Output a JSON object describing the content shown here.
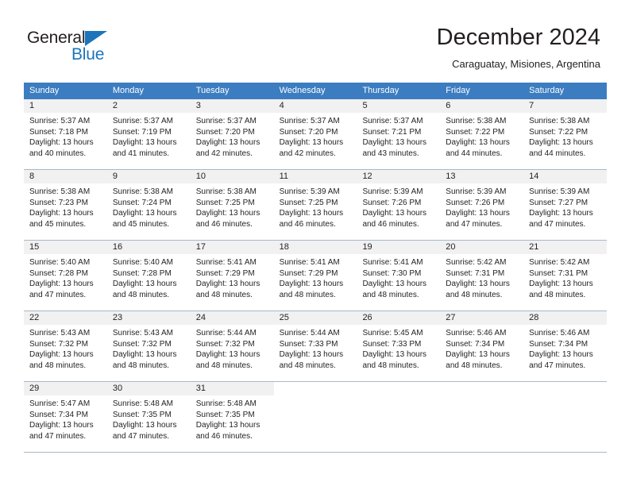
{
  "logo": {
    "word_top": "General",
    "word_bottom": "Blue",
    "triangle_color": "#1b75bb"
  },
  "header": {
    "title": "December 2024",
    "subtitle": "Caraguatay, Misiones, Argentina"
  },
  "theme": {
    "header_bg": "#3b7dc0",
    "header_text": "#ffffff",
    "daynum_bg": "#f1f1f1",
    "grid_line": "#a8b8c8",
    "text": "#231f20"
  },
  "weekdays": [
    "Sunday",
    "Monday",
    "Tuesday",
    "Wednesday",
    "Thursday",
    "Friday",
    "Saturday"
  ],
  "weeks": [
    [
      {
        "day": "1",
        "sunrise": "Sunrise: 5:37 AM",
        "sunset": "Sunset: 7:18 PM",
        "daylight_1": "Daylight: 13 hours",
        "daylight_2": "and 40 minutes."
      },
      {
        "day": "2",
        "sunrise": "Sunrise: 5:37 AM",
        "sunset": "Sunset: 7:19 PM",
        "daylight_1": "Daylight: 13 hours",
        "daylight_2": "and 41 minutes."
      },
      {
        "day": "3",
        "sunrise": "Sunrise: 5:37 AM",
        "sunset": "Sunset: 7:20 PM",
        "daylight_1": "Daylight: 13 hours",
        "daylight_2": "and 42 minutes."
      },
      {
        "day": "4",
        "sunrise": "Sunrise: 5:37 AM",
        "sunset": "Sunset: 7:20 PM",
        "daylight_1": "Daylight: 13 hours",
        "daylight_2": "and 42 minutes."
      },
      {
        "day": "5",
        "sunrise": "Sunrise: 5:37 AM",
        "sunset": "Sunset: 7:21 PM",
        "daylight_1": "Daylight: 13 hours",
        "daylight_2": "and 43 minutes."
      },
      {
        "day": "6",
        "sunrise": "Sunrise: 5:38 AM",
        "sunset": "Sunset: 7:22 PM",
        "daylight_1": "Daylight: 13 hours",
        "daylight_2": "and 44 minutes."
      },
      {
        "day": "7",
        "sunrise": "Sunrise: 5:38 AM",
        "sunset": "Sunset: 7:22 PM",
        "daylight_1": "Daylight: 13 hours",
        "daylight_2": "and 44 minutes."
      }
    ],
    [
      {
        "day": "8",
        "sunrise": "Sunrise: 5:38 AM",
        "sunset": "Sunset: 7:23 PM",
        "daylight_1": "Daylight: 13 hours",
        "daylight_2": "and 45 minutes."
      },
      {
        "day": "9",
        "sunrise": "Sunrise: 5:38 AM",
        "sunset": "Sunset: 7:24 PM",
        "daylight_1": "Daylight: 13 hours",
        "daylight_2": "and 45 minutes."
      },
      {
        "day": "10",
        "sunrise": "Sunrise: 5:38 AM",
        "sunset": "Sunset: 7:25 PM",
        "daylight_1": "Daylight: 13 hours",
        "daylight_2": "and 46 minutes."
      },
      {
        "day": "11",
        "sunrise": "Sunrise: 5:39 AM",
        "sunset": "Sunset: 7:25 PM",
        "daylight_1": "Daylight: 13 hours",
        "daylight_2": "and 46 minutes."
      },
      {
        "day": "12",
        "sunrise": "Sunrise: 5:39 AM",
        "sunset": "Sunset: 7:26 PM",
        "daylight_1": "Daylight: 13 hours",
        "daylight_2": "and 46 minutes."
      },
      {
        "day": "13",
        "sunrise": "Sunrise: 5:39 AM",
        "sunset": "Sunset: 7:26 PM",
        "daylight_1": "Daylight: 13 hours",
        "daylight_2": "and 47 minutes."
      },
      {
        "day": "14",
        "sunrise": "Sunrise: 5:39 AM",
        "sunset": "Sunset: 7:27 PM",
        "daylight_1": "Daylight: 13 hours",
        "daylight_2": "and 47 minutes."
      }
    ],
    [
      {
        "day": "15",
        "sunrise": "Sunrise: 5:40 AM",
        "sunset": "Sunset: 7:28 PM",
        "daylight_1": "Daylight: 13 hours",
        "daylight_2": "and 47 minutes."
      },
      {
        "day": "16",
        "sunrise": "Sunrise: 5:40 AM",
        "sunset": "Sunset: 7:28 PM",
        "daylight_1": "Daylight: 13 hours",
        "daylight_2": "and 48 minutes."
      },
      {
        "day": "17",
        "sunrise": "Sunrise: 5:41 AM",
        "sunset": "Sunset: 7:29 PM",
        "daylight_1": "Daylight: 13 hours",
        "daylight_2": "and 48 minutes."
      },
      {
        "day": "18",
        "sunrise": "Sunrise: 5:41 AM",
        "sunset": "Sunset: 7:29 PM",
        "daylight_1": "Daylight: 13 hours",
        "daylight_2": "and 48 minutes."
      },
      {
        "day": "19",
        "sunrise": "Sunrise: 5:41 AM",
        "sunset": "Sunset: 7:30 PM",
        "daylight_1": "Daylight: 13 hours",
        "daylight_2": "and 48 minutes."
      },
      {
        "day": "20",
        "sunrise": "Sunrise: 5:42 AM",
        "sunset": "Sunset: 7:31 PM",
        "daylight_1": "Daylight: 13 hours",
        "daylight_2": "and 48 minutes."
      },
      {
        "day": "21",
        "sunrise": "Sunrise: 5:42 AM",
        "sunset": "Sunset: 7:31 PM",
        "daylight_1": "Daylight: 13 hours",
        "daylight_2": "and 48 minutes."
      }
    ],
    [
      {
        "day": "22",
        "sunrise": "Sunrise: 5:43 AM",
        "sunset": "Sunset: 7:32 PM",
        "daylight_1": "Daylight: 13 hours",
        "daylight_2": "and 48 minutes."
      },
      {
        "day": "23",
        "sunrise": "Sunrise: 5:43 AM",
        "sunset": "Sunset: 7:32 PM",
        "daylight_1": "Daylight: 13 hours",
        "daylight_2": "and 48 minutes."
      },
      {
        "day": "24",
        "sunrise": "Sunrise: 5:44 AM",
        "sunset": "Sunset: 7:32 PM",
        "daylight_1": "Daylight: 13 hours",
        "daylight_2": "and 48 minutes."
      },
      {
        "day": "25",
        "sunrise": "Sunrise: 5:44 AM",
        "sunset": "Sunset: 7:33 PM",
        "daylight_1": "Daylight: 13 hours",
        "daylight_2": "and 48 minutes."
      },
      {
        "day": "26",
        "sunrise": "Sunrise: 5:45 AM",
        "sunset": "Sunset: 7:33 PM",
        "daylight_1": "Daylight: 13 hours",
        "daylight_2": "and 48 minutes."
      },
      {
        "day": "27",
        "sunrise": "Sunrise: 5:46 AM",
        "sunset": "Sunset: 7:34 PM",
        "daylight_1": "Daylight: 13 hours",
        "daylight_2": "and 48 minutes."
      },
      {
        "day": "28",
        "sunrise": "Sunrise: 5:46 AM",
        "sunset": "Sunset: 7:34 PM",
        "daylight_1": "Daylight: 13 hours",
        "daylight_2": "and 47 minutes."
      }
    ],
    [
      {
        "day": "29",
        "sunrise": "Sunrise: 5:47 AM",
        "sunset": "Sunset: 7:34 PM",
        "daylight_1": "Daylight: 13 hours",
        "daylight_2": "and 47 minutes."
      },
      {
        "day": "30",
        "sunrise": "Sunrise: 5:48 AM",
        "sunset": "Sunset: 7:35 PM",
        "daylight_1": "Daylight: 13 hours",
        "daylight_2": "and 47 minutes."
      },
      {
        "day": "31",
        "sunrise": "Sunrise: 5:48 AM",
        "sunset": "Sunset: 7:35 PM",
        "daylight_1": "Daylight: 13 hours",
        "daylight_2": "and 46 minutes."
      },
      {
        "day": "",
        "sunrise": "",
        "sunset": "",
        "daylight_1": "",
        "daylight_2": ""
      },
      {
        "day": "",
        "sunrise": "",
        "sunset": "",
        "daylight_1": "",
        "daylight_2": ""
      },
      {
        "day": "",
        "sunrise": "",
        "sunset": "",
        "daylight_1": "",
        "daylight_2": ""
      },
      {
        "day": "",
        "sunrise": "",
        "sunset": "",
        "daylight_1": "",
        "daylight_2": ""
      }
    ]
  ]
}
